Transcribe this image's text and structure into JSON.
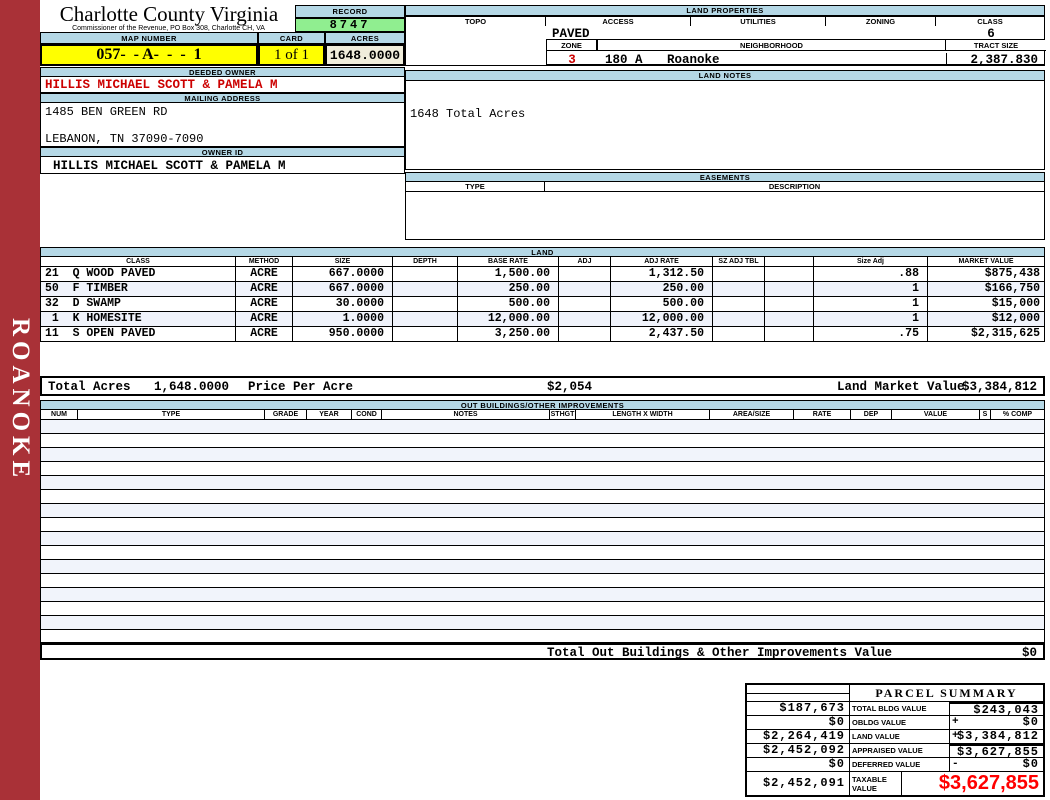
{
  "sidebar": {
    "label": "ROANOKE"
  },
  "header": {
    "title": "Charlotte County Virginia",
    "commissioner": "Commissioner of the Revenue, PO Box 308, Charlotte CH, VA",
    "record_label": "RECORD",
    "record_value": "8747",
    "map_number_label": "MAP NUMBER",
    "map_number_value": "057-  - A-  -  -  1",
    "card_label": "CARD",
    "card_value": "1 of 1",
    "acres_label": "ACRES",
    "acres_value": "1648.0000"
  },
  "owner": {
    "deeded_owner_label": "DEEDED OWNER",
    "deeded_owner": "HILLIS MICHAEL SCOTT & PAMELA M",
    "mailing_address_label": "MAILING ADDRESS",
    "address_line1": "1485 BEN GREEN RD",
    "address_line2": "LEBANON, TN 37090-7090",
    "owner_id_label": "OWNER ID",
    "owner_id": "HILLIS MICHAEL SCOTT & PAMELA M"
  },
  "land_properties": {
    "title": "LAND PROPERTIES",
    "columns": [
      "TOPO",
      "ACCESS",
      "UTILITIES",
      "ZONING",
      "CLASS"
    ],
    "access_value": "PAVED",
    "class_value": "6",
    "zone_label": "ZONE",
    "zone_value": "3",
    "neighborhood_label": "NEIGHBORHOOD",
    "neighborhood_code": "180 A",
    "neighborhood_name": "Roanoke",
    "tract_size_label": "TRACT SIZE",
    "tract_size_value": "2,387.830"
  },
  "land_notes": {
    "title": "LAND NOTES",
    "note": "1648 Total Acres"
  },
  "easements": {
    "title": "EASEMENTS",
    "type_label": "TYPE",
    "description_label": "DESCRIPTION"
  },
  "land": {
    "title": "LAND",
    "columns": [
      "CLASS",
      "METHOD",
      "SIZE",
      "DEPTH",
      "BASE RATE",
      "ADJ",
      "ADJ RATE",
      "SZ ADJ TBL",
      "",
      "Size Adj",
      "MARKET VALUE"
    ],
    "rows": [
      {
        "class": "21  Q WOOD PAVED",
        "method": "ACRE",
        "size": "667.0000",
        "depth": "",
        "base_rate": "1,500.00",
        "adj": "",
        "adj_rate": "1,312.50",
        "sz_adj_tbl": "",
        "blank": "",
        "size_adj": ".88",
        "market_value": "$875,438"
      },
      {
        "class": "50  F TIMBER",
        "method": "ACRE",
        "size": "667.0000",
        "depth": "",
        "base_rate": "250.00",
        "adj": "",
        "adj_rate": "250.00",
        "sz_adj_tbl": "",
        "blank": "",
        "size_adj": "1",
        "market_value": "$166,750"
      },
      {
        "class": "32  D SWAMP",
        "method": "ACRE",
        "size": "30.0000",
        "depth": "",
        "base_rate": "500.00",
        "adj": "",
        "adj_rate": "500.00",
        "sz_adj_tbl": "",
        "blank": "",
        "size_adj": "1",
        "market_value": "$15,000"
      },
      {
        "class": " 1  K HOMESITE",
        "method": "ACRE",
        "size": "1.0000",
        "depth": "",
        "base_rate": "12,000.00",
        "adj": "",
        "adj_rate": "12,000.00",
        "sz_adj_tbl": "",
        "blank": "",
        "size_adj": "1",
        "market_value": "$12,000"
      },
      {
        "class": "11  S OPEN PAVED",
        "method": "ACRE",
        "size": "950.0000",
        "depth": "",
        "base_rate": "3,250.00",
        "adj": "",
        "adj_rate": "2,437.50",
        "sz_adj_tbl": "",
        "blank": "",
        "size_adj": ".75",
        "market_value": "$2,315,625"
      }
    ],
    "totals": {
      "total_acres_label": "Total Acres",
      "total_acres": "1,648.0000",
      "price_per_acre_label": "Price Per Acre",
      "price_per_acre": "$2,054",
      "land_market_value_label": "Land Market Value",
      "land_market_value": "$3,384,812"
    }
  },
  "out_buildings": {
    "title": "OUT BUILDINGS/OTHER IMPROVEMENTS",
    "columns": [
      "NUM",
      "TYPE",
      "GRADE",
      "YEAR",
      "COND",
      "NOTES",
      "STHGT",
      "LENGTH X WIDTH",
      "AREA/SIZE",
      "RATE",
      "DEP",
      "VALUE",
      "S",
      "% COMP"
    ],
    "total_label": "Total Out Buildings & Other Improvements Value",
    "total_value": "$0"
  },
  "parcel_summary": {
    "title": "PARCEL SUMMARY",
    "rows": [
      {
        "prior": "$187,673",
        "label": "TOTAL BLDG VALUE",
        "op": "",
        "value": "$243,043"
      },
      {
        "prior": "$0",
        "label": "OBLDG VALUE",
        "op": "+",
        "value": "$0"
      },
      {
        "prior": "$2,264,419",
        "label": "LAND VALUE",
        "op": "+",
        "value": "$3,384,812"
      },
      {
        "prior": "$2,452,092",
        "label": "APPRAISED VALUE",
        "op": "",
        "value": "$3,627,855"
      },
      {
        "prior": "$0",
        "label": "DEFERRED VALUE",
        "op": "-",
        "value": "$0"
      }
    ],
    "taxable": {
      "prior": "$2,452,091",
      "label": "TAXABLE VALUE",
      "value": "$3,627,855"
    }
  },
  "colors": {
    "sidebar_red": "#A93137",
    "header_blue": "#B5D8E6",
    "record_green": "#90EE90",
    "highlight_yellow": "#FFFF00",
    "acres_beige": "#F0EDDB",
    "alt_row": "#F0F3FB",
    "owner_red": "#CC0000",
    "taxable_red": "#FF0000"
  }
}
